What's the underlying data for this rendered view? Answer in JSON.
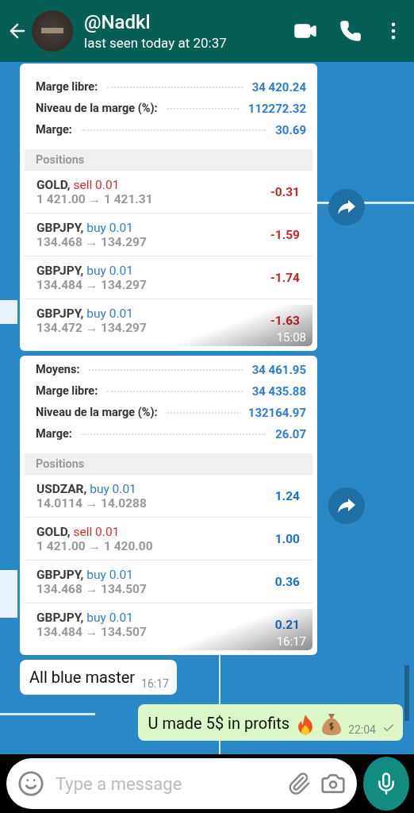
{
  "header": {
    "name": "@Nadkl",
    "status": "last seen today at 20:37"
  },
  "messages": [
    {
      "kind": "screenshot",
      "forward": true,
      "time": "15:08",
      "summary": [
        {
          "label": "Marge libre:",
          "value": "34 420.24"
        },
        {
          "label": "Niveau de la marge (%):",
          "value": "112272.32"
        },
        {
          "label": "Marge:",
          "value": "30.69"
        }
      ],
      "section": "Positions",
      "positions": [
        {
          "symbol": "GOLD,",
          "order": "sell 0.01",
          "color": "#d32f2f",
          "prices": "1 421.00 → 1 421.31",
          "profit": "-0.31",
          "loss": true
        },
        {
          "symbol": "GBPJPY,",
          "order": "buy 0.01",
          "color": "#2f7fd0",
          "prices": "134.468 → 134.297",
          "profit": "-1.59",
          "loss": true
        },
        {
          "symbol": "GBPJPY,",
          "order": "buy 0.01",
          "color": "#2f7fd0",
          "prices": "134.484 → 134.297",
          "profit": "-1.74",
          "loss": true
        },
        {
          "symbol": "GBPJPY,",
          "order": "buy 0.01",
          "color": "#2f7fd0",
          "prices": "134.472 → 134.297",
          "profit": "-1.63",
          "loss": true
        }
      ]
    },
    {
      "kind": "screenshot",
      "forward": true,
      "time": "16:17",
      "summary": [
        {
          "label": "Moyens:",
          "value": "34 461.95"
        },
        {
          "label": "Marge libre:",
          "value": "34 435.88"
        },
        {
          "label": "Niveau de la marge (%):",
          "value": "132164.97"
        },
        {
          "label": "Marge:",
          "value": "26.07"
        }
      ],
      "section": "Positions",
      "positions": [
        {
          "symbol": "USDZAR,",
          "order": "buy 0.01",
          "color": "#2f7fd0",
          "prices": "14.0114 → 14.0288",
          "profit": "1.24",
          "loss": false
        },
        {
          "symbol": "GOLD,",
          "order": "sell 0.01",
          "color": "#d32f2f",
          "prices": "1 421.00 → 1 420.00",
          "profit": "1.00",
          "loss": false
        },
        {
          "symbol": "GBPJPY,",
          "order": "buy 0.01",
          "color": "#2f7fd0",
          "prices": "134.468 → 134.507",
          "profit": "0.36",
          "loss": false
        },
        {
          "symbol": "GBPJPY,",
          "order": "buy 0.01",
          "color": "#2f7fd0",
          "prices": "134.484 → 134.507",
          "profit": "0.21",
          "loss": false
        }
      ]
    },
    {
      "kind": "incoming",
      "text": "All blue master",
      "time": "16:17"
    },
    {
      "kind": "outgoing",
      "text": "U made 5$ in profits",
      "emoji": [
        {
          "kind": "fire"
        },
        {
          "kind": "money-bag"
        }
      ],
      "time": "22:04",
      "sent": true
    }
  ],
  "composer": {
    "placeholder": "Type a message"
  }
}
